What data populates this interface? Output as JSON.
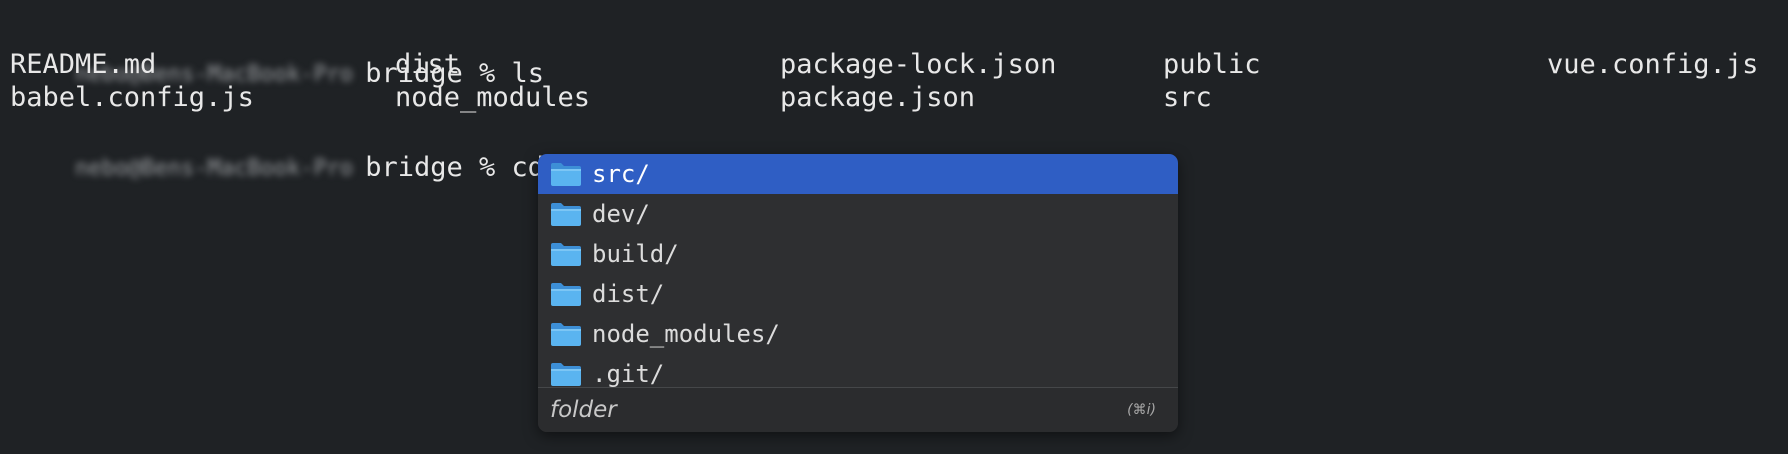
{
  "terminal": {
    "prompt_host": "nebo@Bens-MacBook-Pro",
    "command1": "bridge % ls",
    "ls_rows": [
      [
        "README.md",
        "dist",
        "package-lock.json",
        "public",
        "vue.config.js"
      ],
      [
        "babel.config.js",
        "node_modules",
        "package.json",
        "src",
        ""
      ]
    ],
    "command2": "bridge % cd"
  },
  "autocomplete": {
    "items": [
      {
        "label": "src/",
        "icon": "folder-icon",
        "selected": true
      },
      {
        "label": "dev/",
        "icon": "folder-icon",
        "selected": false
      },
      {
        "label": "build/",
        "icon": "folder-icon",
        "selected": false
      },
      {
        "label": "dist/",
        "icon": "folder-icon",
        "selected": false
      },
      {
        "label": "node_modules/",
        "icon": "folder-icon",
        "selected": false
      },
      {
        "label": ".git/",
        "icon": "folder-icon",
        "selected": false
      }
    ],
    "description": "folder",
    "shortcut": "(⌘i)"
  },
  "colors": {
    "background": "#1f2225",
    "popup": "#2e2f31",
    "selection": "#2f5ec4",
    "folder": "#5ab4f0"
  }
}
